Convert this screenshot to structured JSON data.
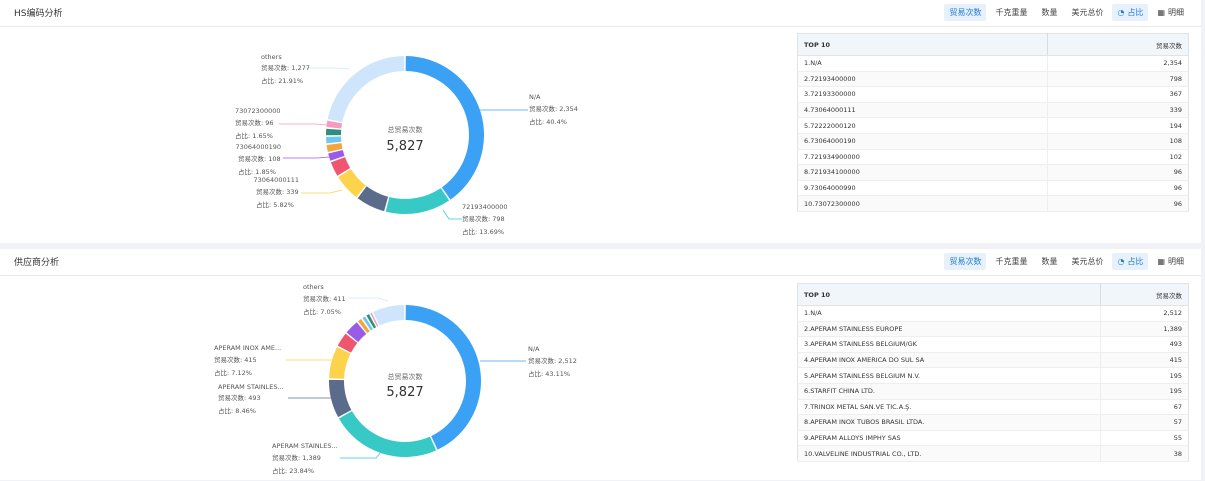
{
  "toolbar": {
    "metrics": [
      "贸易次数",
      "千克重量",
      "数量",
      "美元总价"
    ],
    "ratio_label": "占比",
    "detail_label": "明细"
  },
  "hs": {
    "title": "HS编码分析",
    "center_label": "总贸易次数",
    "center_value": "5,827",
    "table_header": "TOP 10",
    "table_value_header": "贸易次数",
    "table_rows": [
      {
        "name": "1.N/A",
        "value": "2,354"
      },
      {
        "name": "2.72193400000",
        "value": "798"
      },
      {
        "name": "3.72193300000",
        "value": "367"
      },
      {
        "name": "4.73064000111",
        "value": "339"
      },
      {
        "name": "5.72222000120",
        "value": "194"
      },
      {
        "name": "6.73064000190",
        "value": "108"
      },
      {
        "name": "7.721934900000",
        "value": "102"
      },
      {
        "name": "8.721934100000",
        "value": "96"
      },
      {
        "name": "9.73064000990",
        "value": "96"
      },
      {
        "name": "10.73072300000",
        "value": "96"
      }
    ],
    "callouts": [
      {
        "name": "N/A",
        "line2": "贸易次数: 2,354",
        "line3": "占比: 40.4%"
      },
      {
        "name": "72193400000",
        "line2": "贸易次数: 798",
        "line3": "占比: 13.69%"
      },
      {
        "name": "73064000111",
        "line2": "贸易次数: 339",
        "line3": "占比: 5.82%"
      },
      {
        "name": "73064000190",
        "line2": "贸易次数: 108",
        "line3": "占比: 1.85%"
      },
      {
        "name": "73072300000",
        "line2": "贸易次数: 96",
        "line3": "占比: 1.65%"
      },
      {
        "name": "others",
        "line2": "贸易次数: 1,277",
        "line3": "占比: 21.91%"
      }
    ]
  },
  "supplier": {
    "title": "供应商分析",
    "center_label": "总贸易次数",
    "center_value": "5,827",
    "table_header": "TOP 10",
    "table_value_header": "贸易次数",
    "table_rows": [
      {
        "name": "1.N/A",
        "value": "2,512"
      },
      {
        "name": "2.APERAM STAINLESS EUROPE",
        "value": "1,389"
      },
      {
        "name": "3.APERAM STAINLESS BELGIUM/GK",
        "value": "493"
      },
      {
        "name": "4.APERAM INOX AMERICA DO SUL SA",
        "value": "415"
      },
      {
        "name": "5.APERAM STAINLESS BELGIUM N.V.",
        "value": "195"
      },
      {
        "name": "6.STARFIT CHINA LTD.",
        "value": "195"
      },
      {
        "name": "7.TRINOX METAL SAN.VE TIC.A.Ş.",
        "value": "67"
      },
      {
        "name": "8.APERAM INOX TUBOS BRASIL LTDA.",
        "value": "57"
      },
      {
        "name": "9.APERAM ALLOYS IMPHY SAS",
        "value": "55"
      },
      {
        "name": "10.VALVELINE INDUSTRIAL CO., LTD.",
        "value": "38"
      }
    ],
    "callouts": [
      {
        "name": "N/A",
        "line2": "贸易次数: 2,512",
        "line3": "占比: 43.11%"
      },
      {
        "name": "APERAM STAINLES...",
        "line2": "贸易次数: 1,389",
        "line3": "占比: 23.84%"
      },
      {
        "name": "APERAM STAINLES...",
        "line2": "贸易次数: 493",
        "line3": "占比: 8.46%"
      },
      {
        "name": "APERAM INOX AME...",
        "line2": "贸易次数: 415",
        "line3": "占比: 7.12%"
      },
      {
        "name": "others",
        "line2": "贸易次数: 411",
        "line3": "占比: 7.05%"
      }
    ]
  },
  "chart_data": [
    {
      "type": "pie",
      "title": "HS编码分析",
      "total": 5827,
      "slices": [
        {
          "label": "N/A",
          "value": 2354,
          "color": "#3ba1f5"
        },
        {
          "label": "72193400000",
          "value": 798,
          "color": "#36c9c6"
        },
        {
          "label": "72193300000",
          "value": 367,
          "color": "#5a6b8c"
        },
        {
          "label": "73064000111",
          "value": 339,
          "color": "#fcd34a"
        },
        {
          "label": "72222000120",
          "value": 194,
          "color": "#f0566f"
        },
        {
          "label": "73064000190",
          "value": 108,
          "color": "#9a5ce6"
        },
        {
          "label": "721934900000",
          "value": 102,
          "color": "#f4a63b"
        },
        {
          "label": "721934100000",
          "value": 96,
          "color": "#70c8f2"
        },
        {
          "label": "73064000990",
          "value": 96,
          "color": "#2f8f7e"
        },
        {
          "label": "73072300000",
          "value": 96,
          "color": "#f79ac0"
        },
        {
          "label": "others",
          "value": 1277,
          "color": "#cfe5fb"
        }
      ]
    },
    {
      "type": "pie",
      "title": "供应商分析",
      "total": 5827,
      "slices": [
        {
          "label": "N/A",
          "value": 2512,
          "color": "#3ba1f5"
        },
        {
          "label": "APERAM STAINLESS EUROPE",
          "value": 1389,
          "color": "#36c9c6"
        },
        {
          "label": "APERAM STAINLESS BELGIUM/GK",
          "value": 493,
          "color": "#5a6b8c"
        },
        {
          "label": "APERAM INOX AMERICA DO SUL SA",
          "value": 415,
          "color": "#fcd34a"
        },
        {
          "label": "APERAM STAINLESS BELGIUM N.V.",
          "value": 195,
          "color": "#f0566f"
        },
        {
          "label": "STARFIT CHINA LTD.",
          "value": 195,
          "color": "#9a5ce6"
        },
        {
          "label": "TRINOX METAL SAN.VE TIC.A.Ş.",
          "value": 67,
          "color": "#f4a63b"
        },
        {
          "label": "APERAM INOX TUBOS BRASIL LTDA.",
          "value": 57,
          "color": "#70c8f2"
        },
        {
          "label": "APERAM ALLOYS IMPHY SAS",
          "value": 55,
          "color": "#2f8f7e"
        },
        {
          "label": "VALVELINE INDUSTRIAL CO., LTD.",
          "value": 38,
          "color": "#f79ac0"
        },
        {
          "label": "others",
          "value": 411,
          "color": "#cfe5fb"
        }
      ]
    }
  ]
}
